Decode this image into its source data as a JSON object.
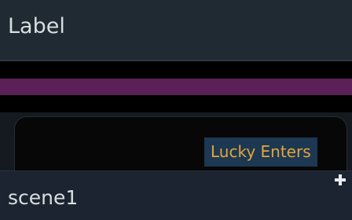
{
  "header": {
    "label": "Label"
  },
  "tooltip": {
    "text": "Lucky Enters"
  },
  "scene": {
    "name": "scene1",
    "add_icon": "plus-icon"
  },
  "colors": {
    "header_bg": "#1f2a33",
    "purple_band": "#5b2058",
    "tooltip_bg": "#1c3852",
    "tooltip_text": "#e6a43a",
    "text": "#d8dde0"
  }
}
